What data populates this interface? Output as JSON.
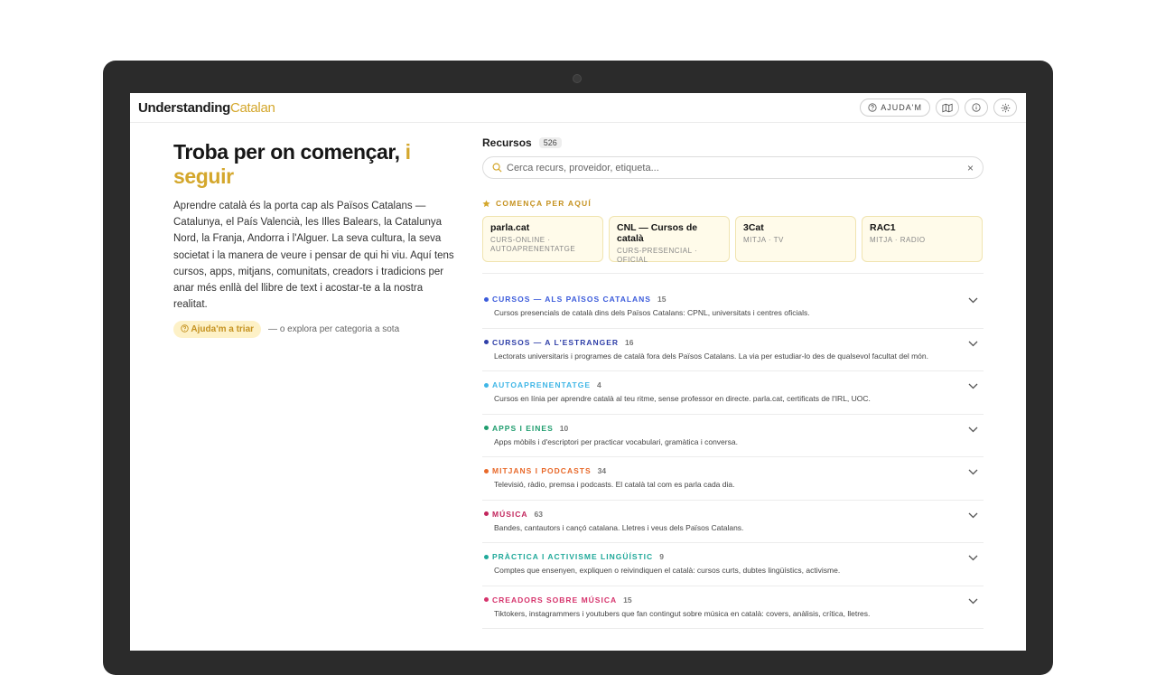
{
  "brand": {
    "name_bold": "Understanding",
    "name_light": "Catalan",
    "accent": "#d4a72c"
  },
  "toolbar": {
    "help_label": "AJUDA'M"
  },
  "hero": {
    "title_main": "Troba per on començar,",
    "title_accent_1": "i",
    "title_accent_2": "seguir",
    "intro": "Aprendre català és la porta cap als Països Catalans — Catalunya, el País Valencià, les Illes Balears, la Catalunya Nord, la Franja, Andorra i l'Alguer. La seva cultura, la seva societat i la manera de veure i pensar de qui hi viu. Aquí tens cursos, apps, mitjans, comunitats, creadors i tradicions per anar més enllà del llibre de text i acostar-te a la nostra realitat.",
    "cta_label": "Ajuda'm a triar",
    "cta_note": "— o explora per categoria a sota"
  },
  "resources": {
    "title": "Recursos",
    "count": "526",
    "search_placeholder": "Cerca recurs, proveidor, etiqueta...",
    "clear_symbol": "×"
  },
  "start_here": {
    "label": "COMENÇA PER AQUÍ",
    "cards": [
      {
        "title": "parla.cat",
        "subtitle": "CURS-ONLINE · AUTOAPRENENTATGE"
      },
      {
        "title": "CNL — Cursos de català",
        "subtitle": "CURS-PRESENCIAL · OFICIAL"
      },
      {
        "title": "3Cat",
        "subtitle": "MITJA · TV"
      },
      {
        "title": "RAC1",
        "subtitle": "MITJA · RADIO"
      }
    ]
  },
  "categories": [
    {
      "name": "CURSOS — ALS PAÏSOS CATALANS",
      "count": "15",
      "color": "#3b5bdb",
      "desc": "Cursos presencials de català dins dels Països Catalans: CPNL, universitats i centres oficials."
    },
    {
      "name": "CURSOS — A L'ESTRANGER",
      "count": "16",
      "color": "#2f3fa8",
      "desc": "Lectorats universitaris i programes de català fora dels Països Catalans. La via per estudiar-lo des de qualsevol facultat del món."
    },
    {
      "name": "AUTOAPRENENTATGE",
      "count": "4",
      "color": "#3fb6e6",
      "desc": "Cursos en línia per aprendre català al teu ritme, sense professor en directe. parla.cat, certificats de l'IRL, UOC."
    },
    {
      "name": "APPS I EINES",
      "count": "10",
      "color": "#1f9d6e",
      "desc": "Apps mòbils i d'escriptori per practicar vocabulari, gramàtica i conversa."
    },
    {
      "name": "MITJANS I PODCASTS",
      "count": "34",
      "color": "#e8692a",
      "desc": "Televisió, ràdio, premsa i podcasts. El català tal com es parla cada dia."
    },
    {
      "name": "MÚSICA",
      "count": "63",
      "color": "#c2255c",
      "desc": "Bandes, cantautors i cançó catalana. Lletres i veus dels Països Catalans."
    },
    {
      "name": "PRÀCTICA I ACTIVISME LINGÜÍSTIC",
      "count": "9",
      "color": "#20a99a",
      "desc": "Comptes que ensenyen, expliquen o reivindiquen el català: cursos curts, dubtes lingüístics, activisme."
    },
    {
      "name": "CREADORS SOBRE MÚSICA",
      "count": "15",
      "color": "#d6336c",
      "desc": "Tiktokers, instagrammers i youtubers que fan contingut sobre música en català: covers, anàlisis, crítica, lletres."
    }
  ]
}
